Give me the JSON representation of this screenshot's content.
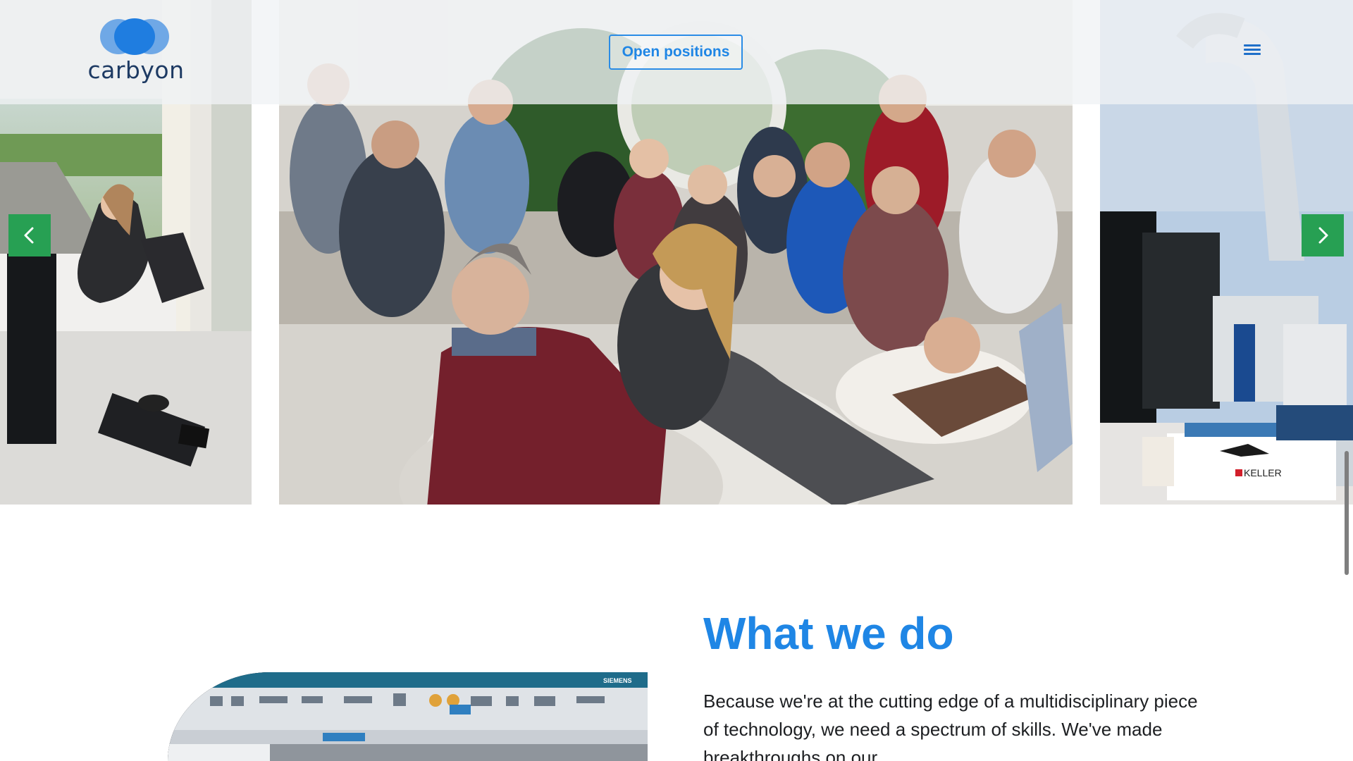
{
  "header": {
    "logo_text": "carbyon",
    "open_positions_label": "Open positions",
    "menu_icon": "hamburger-menu-icon"
  },
  "carousel": {
    "prev_icon": "chevron-left-icon",
    "next_icon": "chevron-right-icon",
    "slides": [
      {
        "label": "office-workstation-photo"
      },
      {
        "label": "team-meeting-photo"
      },
      {
        "label": "lab-equipment-photo",
        "sticker_text": "KELLER"
      }
    ]
  },
  "what_we_do": {
    "title": "What we do",
    "body": "Because we're at the cutting edge of a multidisciplinary piece of technology, we need a spectrum of skills. We've made breakthroughs on our"
  },
  "cad_screenshot": {
    "brand": "SIEMENS"
  },
  "colors": {
    "accent_blue": "#1f86e5",
    "arrow_green": "#27a053",
    "logo_navy": "#1d3a63"
  }
}
